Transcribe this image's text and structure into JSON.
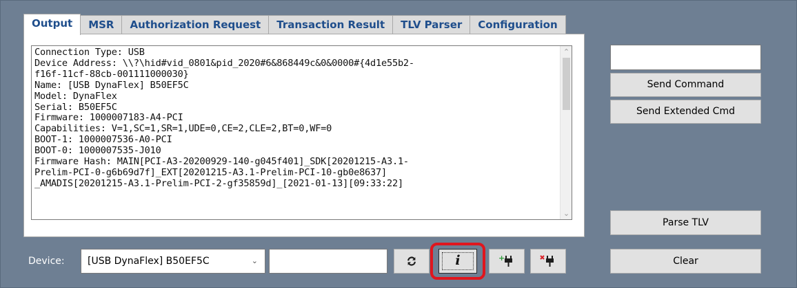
{
  "tabs": [
    {
      "label": "Output",
      "active": true
    },
    {
      "label": "MSR"
    },
    {
      "label": "Authorization Request"
    },
    {
      "label": "Transaction Result"
    },
    {
      "label": "TLV Parser"
    },
    {
      "label": "Configuration"
    }
  ],
  "output_lines": [
    "Connection Type: USB",
    "Device Address: \\\\?\\hid#vid_0801&pid_2020#6&868449c&0&0000#{4d1e55b2-",
    "f16f-11cf-88cb-001111000030}",
    "Name: [USB DynaFlex] B50EF5C",
    "Model: DynaFlex",
    "Serial: B50EF5C",
    "Firmware: 1000007183-A4-PCI",
    "Capabilities: V=1,SC=1,SR=1,UDE=0,CE=2,CLE=2,BT=0,WF=0",
    "BOOT-1: 1000007536-A0-PCI",
    "BOOT-0: 1000007535-J010",
    "Firmware Hash: MAIN[PCI-A3-20200929-140-g045f401]_SDK[20201215-A3.1-",
    "Prelim-PCI-0-g6b69d7f]_EXT[20201215-A3.1-Prelim-PCI-10-gb0e8637]",
    "_AMADIS[20201215-A3.1-Prelim-PCI-2-gf35859d]_[2021-01-13][09:33:22]"
  ],
  "command_input": {
    "value": ""
  },
  "buttons": {
    "send_command": "Send Command",
    "send_extended_cmd": "Send Extended Cmd",
    "parse_tlv": "Parse TLV",
    "clear": "Clear"
  },
  "device": {
    "label": "Device:",
    "selected": "[USB DynaFlex] B50EF5C",
    "extra_input": ""
  },
  "toolbar_icons": [
    "refresh-icon",
    "info-icon",
    "connect-plug-icon",
    "disconnect-plug-icon"
  ],
  "info_glyph": "i",
  "colors": {
    "background": "#6e7f93",
    "tab_text": "#1f4e8c",
    "highlight": "#e0161e",
    "connect_green": "#2e9c3a",
    "disconnect_red": "#d9232a"
  }
}
